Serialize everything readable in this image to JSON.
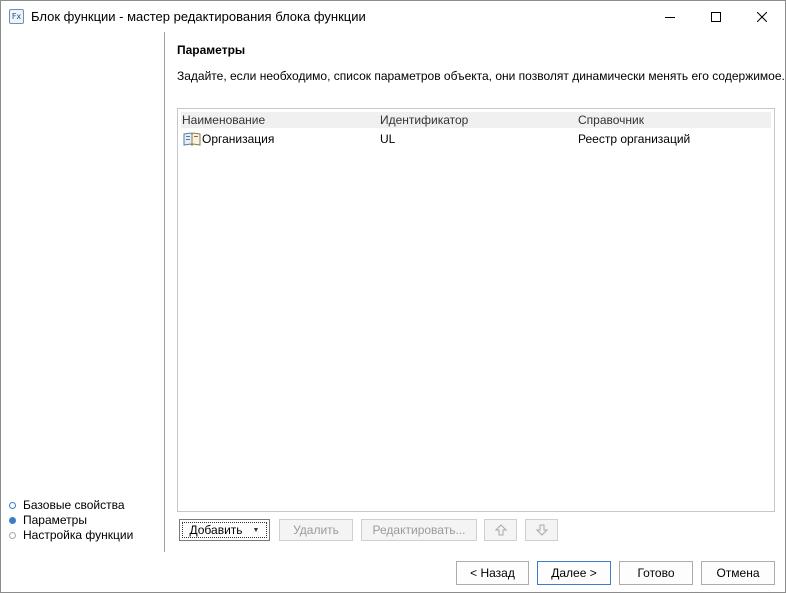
{
  "window": {
    "title": "Блок функции - мастер редактирования блока функции",
    "icon_text": "Fx"
  },
  "steps": [
    {
      "label": "Базовые свойства",
      "state": "done"
    },
    {
      "label": "Параметры",
      "state": "active"
    },
    {
      "label": "Настройка функции",
      "state": "future"
    }
  ],
  "section": {
    "title": "Параметры",
    "description": "Задайте, если необходимо, список параметров объекта, они позволят динамически менять его содержимое."
  },
  "grid": {
    "columns": [
      "Наименование",
      "Идентификатор",
      "Справочник"
    ],
    "rows": [
      {
        "name": "Организация",
        "id": "UL",
        "ref": "Реестр организаций",
        "icon": "book-icon"
      }
    ]
  },
  "toolbar": {
    "add_label": "Добавить",
    "delete_label": "Удалить",
    "edit_label": "Редактировать...",
    "move_up_icon": "arrow-up-icon",
    "move_down_icon": "arrow-down-icon"
  },
  "footer": {
    "back_label": "< Назад",
    "next_label": "Далее >",
    "done_label": "Готово",
    "cancel_label": "Отмена"
  },
  "colors": {
    "accent": "#3a7fc4",
    "header_bg": "#f0f0f0",
    "disabled_text": "#9a9a9a"
  }
}
